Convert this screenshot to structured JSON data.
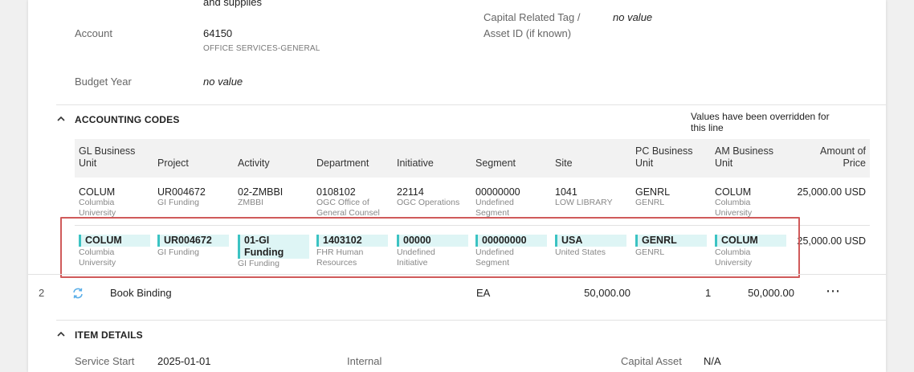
{
  "top_fields": {
    "description_tail": "and supplies",
    "account_label": "Account",
    "account_value": "64150",
    "account_sub": "OFFICE SERVICES-GENERAL",
    "capital_tag_label_1": "Capital Related Tag /",
    "capital_tag_label_2": "Asset ID (if known)",
    "capital_tag_value": "no value",
    "budget_year_label": "Budget Year",
    "budget_year_value": "no value"
  },
  "accounting_codes": {
    "title": "ACCOUNTING CODES",
    "override_note": "Values have been overridden for this line",
    "headers": {
      "gl": [
        "GL Business",
        "Unit"
      ],
      "project": "Project",
      "activity": "Activity",
      "department": "Department",
      "initiative": "Initiative",
      "segment": "Segment",
      "site": "Site",
      "pc": [
        "PC Business",
        "Unit"
      ],
      "am": [
        "AM Business",
        "Unit"
      ],
      "amount": [
        "Amount of",
        "Price"
      ]
    },
    "default_row": {
      "gl": {
        "main": "COLUM",
        "sub1": "Columbia",
        "sub2": "University"
      },
      "project": {
        "main": "UR004672",
        "sub1": "GI Funding"
      },
      "activity": {
        "main": "02-ZMBBI",
        "sub1": "ZMBBI"
      },
      "department": {
        "main": "0108102",
        "sub1": "OGC Office of",
        "sub2": "General Counsel"
      },
      "initiative": {
        "main": "22114",
        "sub1": "OGC Operations"
      },
      "segment": {
        "main": "00000000",
        "sub1": "Undefined",
        "sub2": "Segment"
      },
      "site": {
        "main": "1041",
        "sub1": "LOW LIBRARY"
      },
      "pc": {
        "main": "GENRL",
        "sub1": "GENRL"
      },
      "am": {
        "main": "COLUM",
        "sub1": "Columbia",
        "sub2": "University"
      },
      "amount": "25,000.00 USD"
    },
    "override_row": {
      "gl": {
        "main": "COLUM",
        "sub1": "Columbia",
        "sub2": "University"
      },
      "project": {
        "main": "UR004672",
        "sub1": "GI Funding"
      },
      "activity": {
        "main1": "01-GI",
        "main2": "Funding",
        "sub1": "GI Funding"
      },
      "department": {
        "main": "1403102",
        "sub1": "FHR Human",
        "sub2": "Resources"
      },
      "initiative": {
        "main": "00000",
        "sub1": "Undefined",
        "sub2": "Initiative"
      },
      "segment": {
        "main": "00000000",
        "sub1": "Undefined",
        "sub2": "Segment"
      },
      "site": {
        "main": "USA",
        "sub1": "United States"
      },
      "pc": {
        "main": "GENRL",
        "sub1": "GENRL"
      },
      "am": {
        "main": "COLUM",
        "sub1": "Columbia",
        "sub2": "University"
      },
      "amount": "25,000.00 USD"
    }
  },
  "line2": {
    "number": "2",
    "description": "Book Binding",
    "uom": "EA",
    "unit_price": "50,000.00",
    "quantity": "1",
    "total": "50,000.00",
    "more": "⋯"
  },
  "item_details": {
    "title": "ITEM DETAILS",
    "service_start_label": "Service Start",
    "service_start_value": "2025-01-01",
    "internal_label": "Internal",
    "capital_asset_label": "Capital Asset",
    "capital_asset_value": "N/A"
  },
  "colors": {
    "chip_bg": "#def5f5",
    "chip_accent": "#3cc3c3",
    "highlight": "#d05a5a",
    "sync_icon": "#5aaee8"
  }
}
